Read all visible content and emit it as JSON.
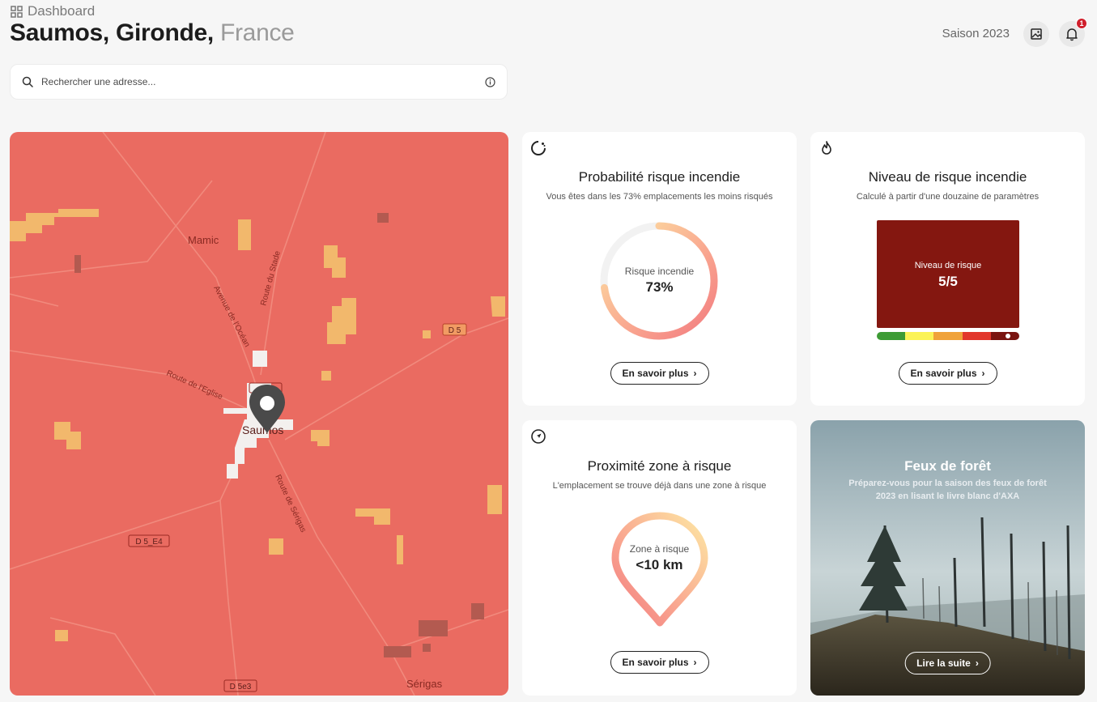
{
  "header": {
    "breadcrumb": "Dashboard",
    "title_place": "Saumos, Gironde,",
    "title_country": "France",
    "season": "Saison 2023",
    "notifications_count": "1"
  },
  "search": {
    "placeholder": "Rechercher une adresse..."
  },
  "map": {
    "labels": {
      "mamic": "Mamic",
      "saumos": "Saumos",
      "serigas": "Sérigas",
      "avenue_ocean": "Avenue de l'Océan",
      "route_stade": "Route du Stade",
      "route_eglise": "Route de l'Eglise",
      "route_serigas": "Route de Sérigas"
    },
    "road_badges": {
      "d5": "D 5",
      "d5_e4": "D 5_E4",
      "d5e3": "D 5e3"
    },
    "colors": {
      "background": "#ea6b61",
      "patch_light": "#f2b86c",
      "patch_dark": "#b35a50"
    }
  },
  "cards": {
    "probability": {
      "title": "Probabilité risque incendie",
      "subtitle": "Vous êtes dans les 73% emplacements les moins risqués",
      "gauge_label": "Risque incendie",
      "gauge_value": "73%",
      "gauge_fraction": 0.73,
      "button": "En savoir plus"
    },
    "level": {
      "title": "Niveau de risque incendie",
      "subtitle": "Calculé à partir d'une douzaine de paramètres",
      "box_label": "Niveau de risque",
      "box_value": "5/5",
      "level": 5,
      "scale_colors": [
        "#3d9b35",
        "#fbf356",
        "#f0a23a",
        "#e2362c",
        "#7a1410"
      ],
      "button": "En savoir plus"
    },
    "proximity": {
      "title": "Proximité zone à risque",
      "subtitle": "L'emplacement se trouve déjà dans une zone à risque",
      "pin_label": "Zone à risque",
      "pin_value": "<10 km",
      "button": "En savoir plus"
    },
    "forest": {
      "title": "Feux de forêt",
      "subtitle_line1": "Préparez-vous pour la saison des feux de forêt",
      "subtitle_line2": "2023 en lisant le livre blanc d'AXA",
      "button": "Lire la suite"
    }
  }
}
